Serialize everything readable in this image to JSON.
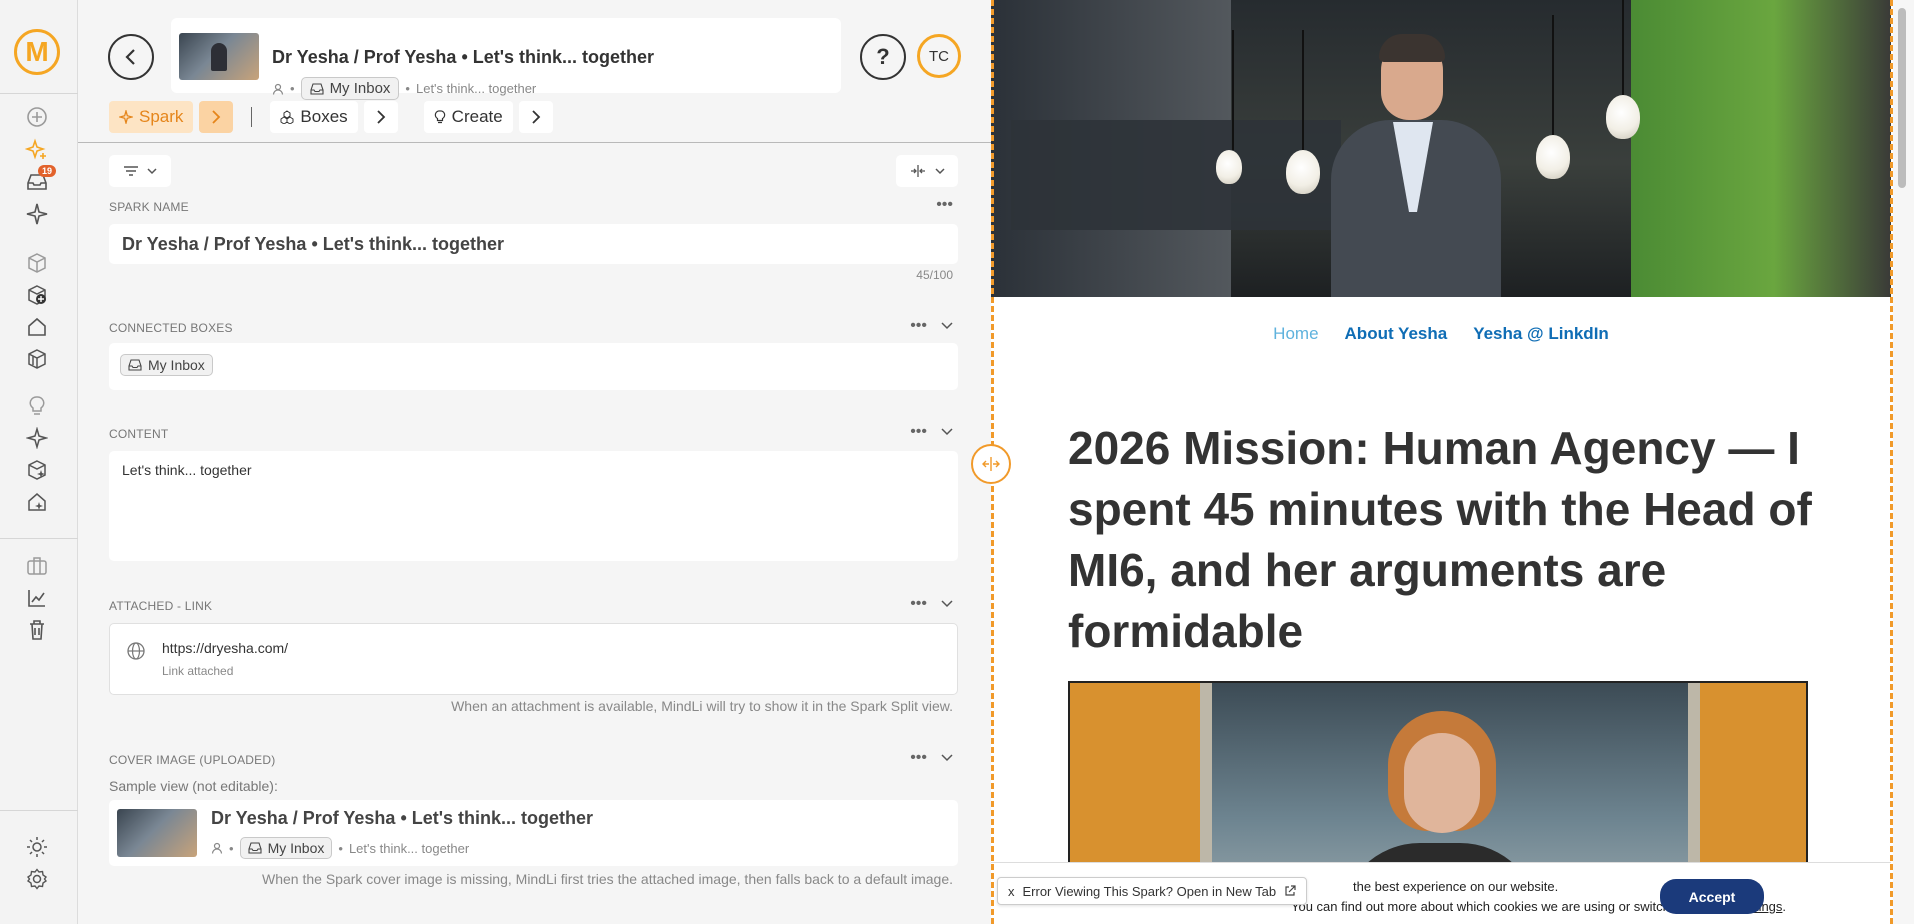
{
  "rail": {
    "logo": "M",
    "inbox_badge": "19",
    "icons": [
      "add-circle-icon",
      "spark-add-icon",
      "inbox-icon",
      "sparkles-icon",
      "box-icon",
      "box-add-icon",
      "home-icon",
      "box-stack-icon",
      "lightbulb-icon",
      "spark-outline-icon",
      "box-spark-icon",
      "home-spark-icon",
      "briefcase-icon",
      "chart-icon",
      "trash-icon",
      "sun-icon",
      "settings-icon"
    ]
  },
  "header": {
    "title": "Dr Yesha / Prof Yesha • Let's think... together",
    "inbox_chip": "My Inbox",
    "subtitle": "Let's think... together",
    "help": "?",
    "avatar": "TC"
  },
  "toolbar": {
    "spark": "Spark",
    "boxes": "Boxes",
    "create": "Create"
  },
  "sections": {
    "spark_name": {
      "label": "SPARK NAME",
      "value": "Dr Yesha / Prof Yesha • Let's think... together",
      "count": "45/100"
    },
    "connected_boxes": {
      "label": "CONNECTED BOXES",
      "chip": "My Inbox"
    },
    "content": {
      "label": "CONTENT",
      "value": "Let's think... together"
    },
    "attached_link": {
      "label": "ATTACHED - LINK",
      "url": "https://dryesha.com/",
      "status": "Link attached",
      "hint": "When an attachment is available, MindLi will try to show it in the Spark Split view."
    },
    "cover_image": {
      "label": "COVER IMAGE (UPLOADED)",
      "sample_label": "Sample view (not editable):",
      "title": "Dr Yesha / Prof Yesha • Let's think... together",
      "chip": "My Inbox",
      "subtitle": "Let's think... together",
      "hint": "When the Spark cover image is missing, MindLi first tries the attached image, then falls back to a default image."
    }
  },
  "webview": {
    "nav": [
      "Home",
      "About Yesha",
      "Yesha @ LinkdIn"
    ],
    "article_title": "2026 Mission: Human Agency — I spent 45 minutes with the Head of MI6, and her arguments are formidable",
    "cookie_line1": "the best experience on our website.",
    "cookie_line2_pre": "You can find out more about which cookies we are using or switch them off in",
    "cookie_link": "settings",
    "cookie_end": ".",
    "accept": "Accept",
    "error_close": "x",
    "error_text": "Error Viewing This Spark? Open in New Tab"
  },
  "colors": {
    "accent": "#f5a623",
    "link_blue": "#0f6db5",
    "accept_bg": "#1b3a7b"
  }
}
